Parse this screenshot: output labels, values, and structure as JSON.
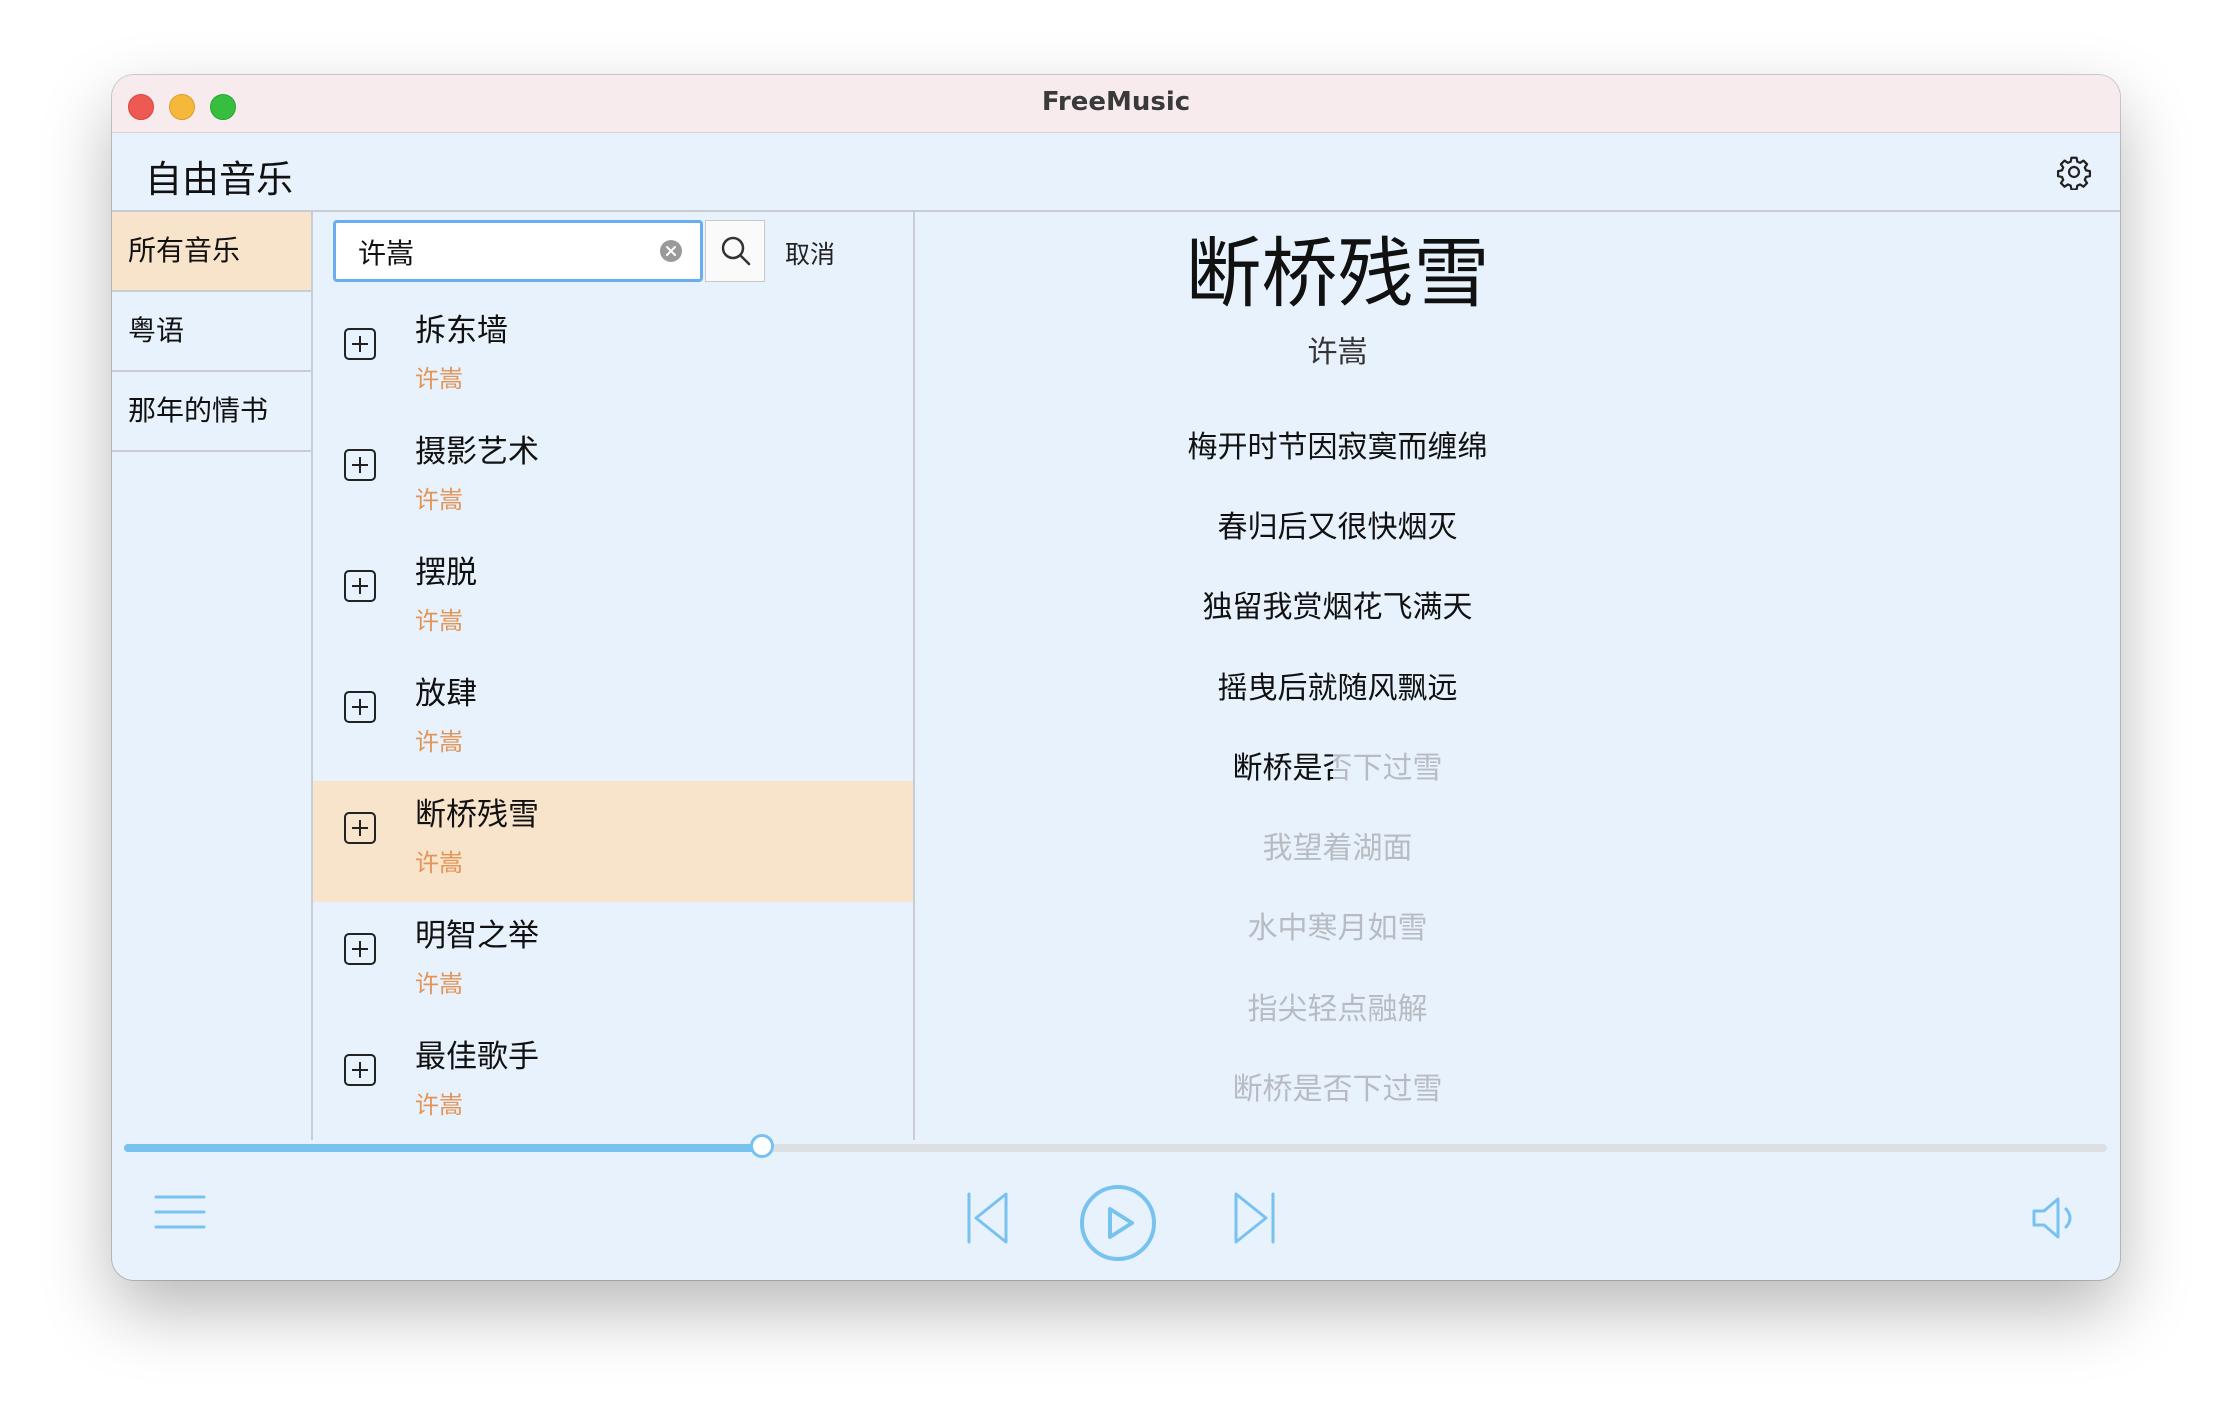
{
  "window": {
    "title": "FreeMusic"
  },
  "header": {
    "title": "自由音乐"
  },
  "sidebar": {
    "items": [
      {
        "label": "所有音乐"
      },
      {
        "label": "粤语"
      },
      {
        "label": "那年的情书"
      }
    ],
    "active_index": 0
  },
  "search": {
    "value": "许嵩",
    "cancel_label": "取消"
  },
  "songs": [
    {
      "title": "拆东墙",
      "artist": "许嵩"
    },
    {
      "title": "摄影艺术",
      "artist": "许嵩"
    },
    {
      "title": "摆脱",
      "artist": "许嵩"
    },
    {
      "title": "放肆",
      "artist": "许嵩"
    },
    {
      "title": "断桥残雪",
      "artist": "许嵩"
    },
    {
      "title": "明智之举",
      "artist": "许嵩"
    },
    {
      "title": "最佳歌手",
      "artist": "许嵩"
    }
  ],
  "active_song_index": 4,
  "now_playing": {
    "title": "断桥残雪",
    "artist": "许嵩",
    "lyrics": [
      "梅开时节因寂寞而缠绵",
      "春归后又很快烟灭",
      "独留我赏烟花飞满天",
      "摇曳后就随风飘远",
      "断桥是否下过雪",
      "我望着湖面",
      "水中寒月如雪",
      "指尖轻点融解",
      "断桥是否下过雪"
    ],
    "current_lyric_index": 4,
    "current_lyric_progress": 0.48
  },
  "playback": {
    "progress": 0.322,
    "state": "paused"
  },
  "colors": {
    "accent": "#78c2f0",
    "active_row": "#f8e3cb",
    "artist_text": "#e39457",
    "background": "#e8f2fc"
  },
  "icons": {
    "settings": "gear-icon",
    "add": "plus-square-icon",
    "search": "search-icon",
    "clear": "clear-icon",
    "playlist": "menu-icon",
    "previous": "skip-previous-icon",
    "play": "play-icon",
    "next": "skip-next-icon",
    "volume": "volume-icon"
  }
}
